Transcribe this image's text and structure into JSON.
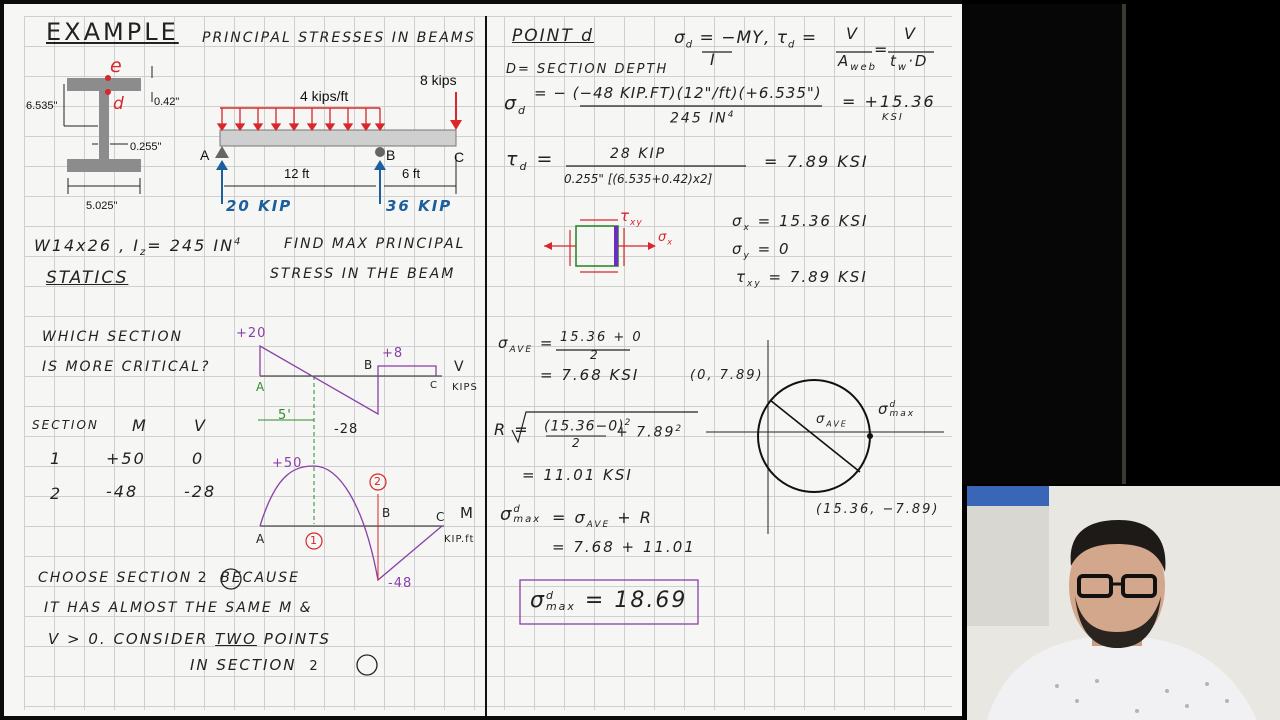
{
  "header": {
    "example": "EXAMPLE",
    "topic": "PRINCIPAL  STRESSES  IN  BEAMS",
    "point": "POINT  d"
  },
  "section_figure": {
    "label_e": "e",
    "label_d": "d",
    "dim_depth": "6.535\"",
    "dim_042": "0.42\"",
    "dim_web": "0.255\"",
    "dim_flange": "5.025\""
  },
  "beam_figure": {
    "load_dist": "4  kips/ft",
    "load_point": "8  kips",
    "label_a": "A",
    "label_b": "B",
    "label_c": "C",
    "span_ab": "12 ft",
    "span_bc": "6 ft",
    "reaction_a": "20 KIP",
    "reaction_b": "36 KIP"
  },
  "left_notes": {
    "section_props": "W14x26 , I",
    "iz_sub": "z",
    "iz_val": "= 245 IN",
    "iz_exp": "4",
    "find1": "FIND MAX PRINCIPAL",
    "find2": "STRESS IN THE BEAM",
    "statics": "STATICS",
    "which1": "WHICH  SECTION",
    "which2": "IS  MORE  CRITICAL?",
    "choose1": "CHOOSE SECTION",
    "choose_circ": "2",
    "choose1b": "BECAUSE",
    "choose2": "IT HAS ALMOST THE SAME M &",
    "choose3a": "V > 0.  CONSIDER",
    "choose3b": "TWO",
    "choose3c": "POINTS",
    "choose4": "IN  SECTION",
    "choose4_circ": "2"
  },
  "table": {
    "headers": [
      "SECTION",
      "M",
      "V"
    ],
    "rows": [
      [
        "1",
        "+50",
        "0"
      ],
      [
        "2",
        "-48",
        "-28"
      ]
    ]
  },
  "diagrams": {
    "shear_pos": "+20",
    "shear_b": "+8",
    "shear_label": "V",
    "shear_unit": "KIPS",
    "shear_neg": "-28",
    "shear_dist": "5'",
    "moment_pos": "+50",
    "moment_neg": "-48",
    "moment_label": "M",
    "moment_unit": "KIP.ft",
    "circle_1": "1",
    "circle_2": "2",
    "a": "A",
    "b": "B",
    "c": "C"
  },
  "right_calc": {
    "formula_sigma": "σ",
    "formula_sigma_sub": "d",
    "formula_sigma_rhs": "= −MY",
    "formula_sigma_den": "I",
    "formula_tau": ", τ",
    "formula_tau_sub": "d",
    "formula_tau_eq": "=",
    "formula_v1": "V",
    "formula_aweb": "A",
    "formula_aweb_sub": "web",
    "formula_eq2": "=",
    "formula_v2": "V",
    "formula_twd": "t",
    "formula_twd_sub": "w",
    "formula_twd_d": "·D",
    "depth_note": "D= SECTION  DEPTH",
    "sigma_d_lhs": "σ",
    "sigma_d_sub": "d",
    "sigma_d_num": "= − (−48 KIP.FT)(12\"/ft)(+6.535\")",
    "sigma_d_den": "245  IN",
    "sigma_d_den_exp": "4",
    "sigma_d_result": "= +15.36",
    "sigma_d_unit": "KSI",
    "tau_d_lhs": "τ",
    "tau_d_sub": "d",
    "tau_d_num": "28  KIP",
    "tau_d_den": "0.255\" [(6.535+0.42)x2]",
    "tau_d_result": "= 7.89 KSI",
    "elem_tau": "τ",
    "elem_tau_sub": "xy",
    "elem_sigma": "σ",
    "elem_sigma_sub": "x",
    "sx": "σ",
    "sx_sub": "x",
    "sx_val": "= 15.36  KSI",
    "sy": "σ",
    "sy_sub": "y",
    "sy_val": "= 0",
    "txy": "τ",
    "txy_sub": "xy",
    "txy_val": "= 7.89  KSI",
    "save_lhs": "σ",
    "save_sub": "AVE",
    "save_num": "15.36 + 0",
    "save_den": "2",
    "save_res": "= 7.68  KSI",
    "r_lhs": "R =",
    "r_expr": "(15.36−0)",
    "r_expr_den": "2",
    "r_expr_tail": "+ 7.89",
    "r_res": "= 11.01 KSI",
    "smax_lhs": "σ",
    "smax_sup": "d",
    "smax_sub": "max",
    "smax_eq": "= σ",
    "smax_eq_sub": "AVE",
    "smax_eq_tail": "+ R",
    "smax_line2": "= 7.68 + 11.01",
    "boxed_lhs": "σ",
    "boxed_sup": "d",
    "boxed_sub": "max",
    "boxed_val": "= 18.69",
    "mohr_pt1": "(0, 7.89)",
    "mohr_pt2": "(15.36, −7.89)",
    "mohr_center": "σ",
    "mohr_center_sub": "AVE",
    "mohr_max": "σ",
    "mohr_max_sup": "d",
    "mohr_max_sub": "max"
  },
  "colors": {
    "red": "#d8262a",
    "blue": "#1c5f9c",
    "purple": "#8a3fa8",
    "green": "#2f8a2f",
    "ink": "#222222"
  }
}
